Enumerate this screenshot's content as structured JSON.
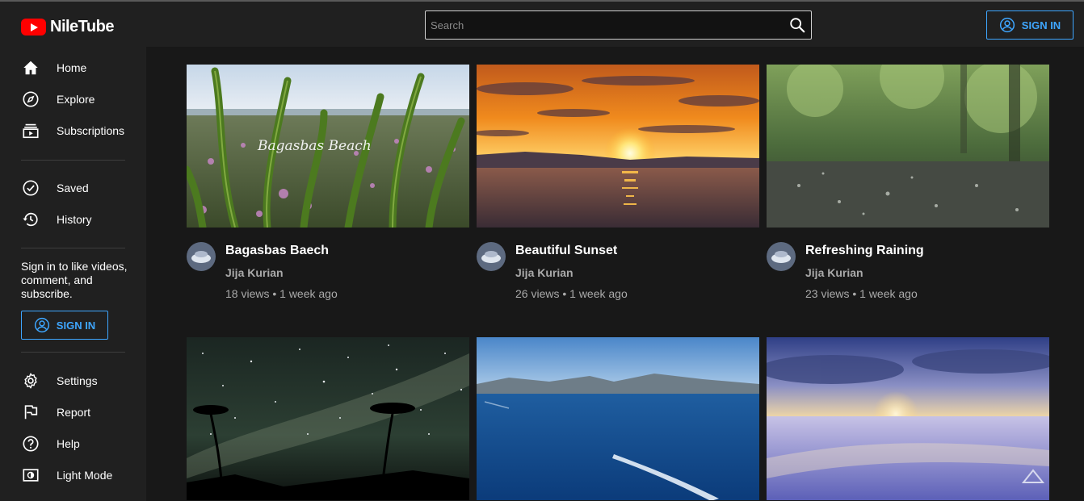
{
  "app": {
    "name": "NileTube"
  },
  "search": {
    "placeholder": "Search"
  },
  "header": {
    "signin_label": "SIGN IN"
  },
  "sidebar": {
    "items_main": [
      {
        "label": "Home",
        "icon": "home-icon"
      },
      {
        "label": "Explore",
        "icon": "compass-icon"
      },
      {
        "label": "Subscriptions",
        "icon": "subscriptions-icon"
      }
    ],
    "items_library": [
      {
        "label": "Saved",
        "icon": "check-circle-icon"
      },
      {
        "label": "History",
        "icon": "history-icon"
      }
    ],
    "signin_message": "Sign in to like videos, comment, and subscribe.",
    "signin_label": "SIGN IN",
    "items_footer": [
      {
        "label": "Settings",
        "icon": "gear-icon"
      },
      {
        "label": "Report",
        "icon": "flag-icon"
      },
      {
        "label": "Help",
        "icon": "help-icon"
      },
      {
        "label": "Light Mode",
        "icon": "light-mode-icon"
      }
    ]
  },
  "videos": [
    {
      "title": "Bagasbas Baech",
      "channel": "Jija Kurian",
      "meta": "18 views • 1 week ago",
      "thumb_text": "Bagasbas Beach"
    },
    {
      "title": "Beautiful Sunset",
      "channel": "Jija Kurian",
      "meta": "26 views • 1 week ago"
    },
    {
      "title": "Refreshing Raining",
      "channel": "Jija Kurian",
      "meta": "23 views • 1 week ago"
    },
    {
      "title": "",
      "channel": "",
      "meta": ""
    },
    {
      "title": "",
      "channel": "",
      "meta": ""
    },
    {
      "title": "",
      "channel": "",
      "meta": ""
    }
  ],
  "colors": {
    "accent": "#3ea6ff",
    "brand_red": "#ff0000",
    "background": "#181818",
    "panel": "#202020"
  }
}
